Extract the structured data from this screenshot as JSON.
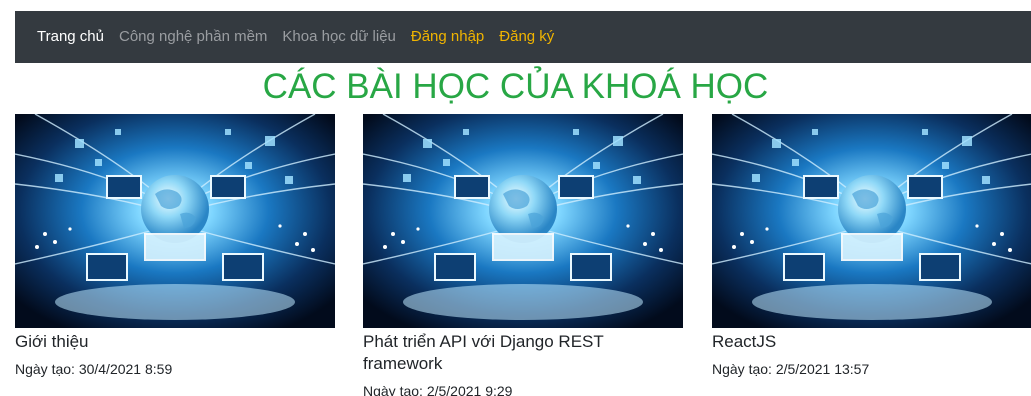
{
  "navbar": {
    "items": [
      {
        "label": "Trang chủ"
      },
      {
        "label": "Công nghệ phần mềm"
      },
      {
        "label": "Khoa học dữ liệu"
      },
      {
        "label": "Đăng nhập"
      },
      {
        "label": "Đăng ký"
      }
    ],
    "colors": {
      "background": "#343a40",
      "active": "#ffffff",
      "muted": "#9a9da1",
      "auth": "#f0b400"
    }
  },
  "page_title": "CÁC BÀI HỌC CỦA KHOÁ HỌC",
  "title_color": "#28a745",
  "lessons": [
    {
      "title": "Giới thiệu",
      "date": "Ngày tạo: 30/4/2021 8:59",
      "image": "network-globe-image"
    },
    {
      "title": "Phát triển API với Django REST framework",
      "date": "Ngày tạo: 2/5/2021 9:29",
      "image": "network-globe-image"
    },
    {
      "title": "ReactJS",
      "date": "Ngày tạo: 2/5/2021 13:57",
      "image": "network-globe-image"
    }
  ]
}
